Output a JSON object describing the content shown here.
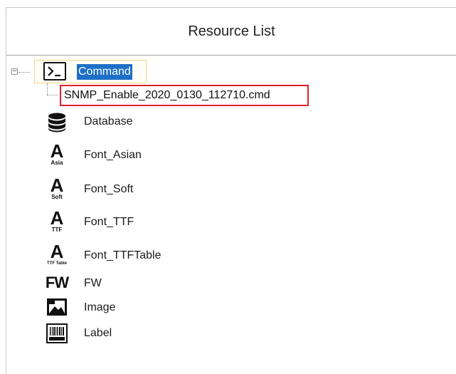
{
  "header": {
    "title": "Resource List"
  },
  "tree": {
    "expander_symbol": "−",
    "command": {
      "label": "Command",
      "icon": "terminal-icon",
      "icon_text": ">_"
    },
    "selected_file": "SNMP_Enable_2020_0130_112710.cmd",
    "highlight_color": "#e0202a",
    "selection_color": "#1e6fc7",
    "items": [
      {
        "label": "Database",
        "icon": "database-icon"
      },
      {
        "label": "Font_Asian",
        "icon": "font-asian-icon",
        "icon_letter": "A",
        "icon_sub": "Asia"
      },
      {
        "label": "Font_Soft",
        "icon": "font-soft-icon",
        "icon_letter": "A",
        "icon_sub": "Soft"
      },
      {
        "label": "Font_TTF",
        "icon": "font-ttf-icon",
        "icon_letter": "A",
        "icon_sub": "TTF"
      },
      {
        "label": "Font_TTFTable",
        "icon": "font-ttftable-icon",
        "icon_letter": "A",
        "icon_sub": "TTF Table"
      },
      {
        "label": "FW",
        "icon": "firmware-icon",
        "icon_text": "FW"
      },
      {
        "label": "Image",
        "icon": "image-icon"
      },
      {
        "label": "Label",
        "icon": "barcode-label-icon",
        "icon_sub": "AB12345"
      }
    ]
  }
}
